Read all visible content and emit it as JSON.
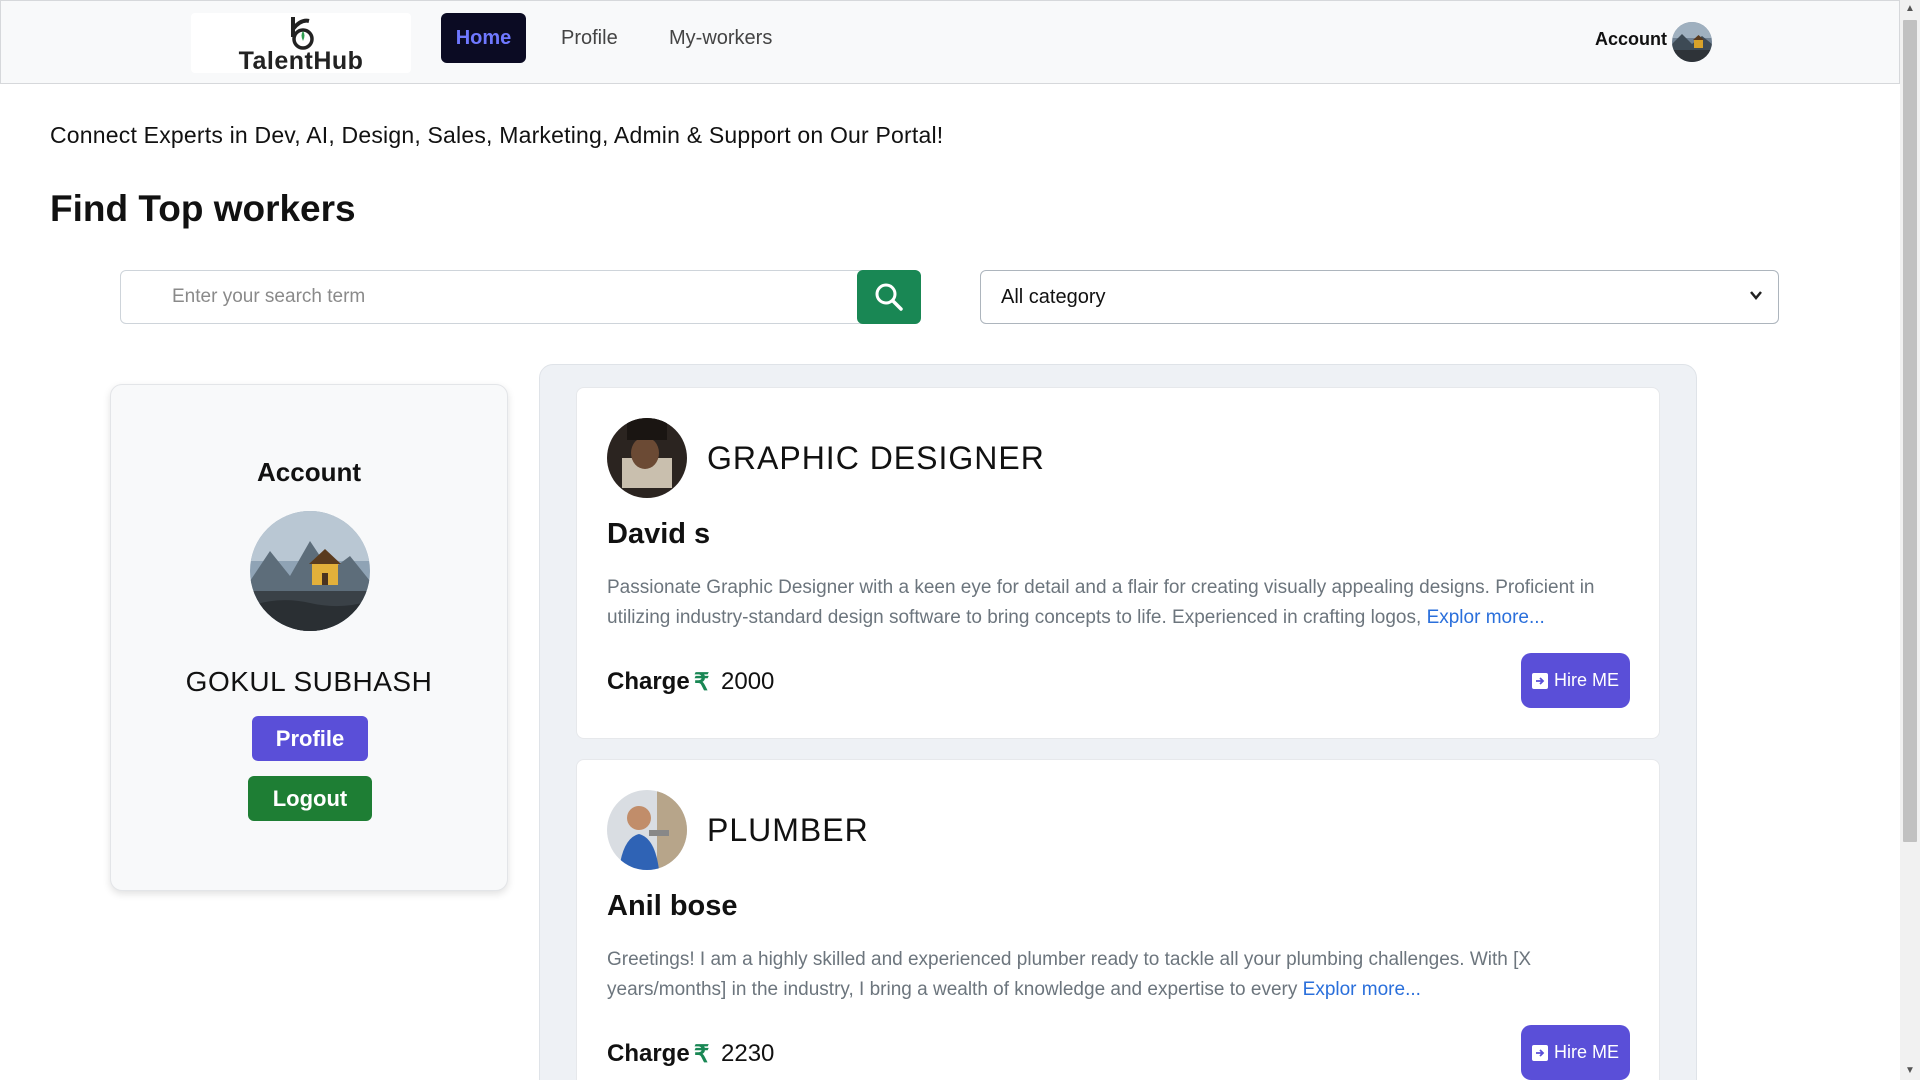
{
  "navbar": {
    "logo_text": "TalentHub",
    "links": [
      {
        "label": "Home",
        "active": true
      },
      {
        "label": "Profile"
      },
      {
        "label": "My-workers"
      }
    ],
    "account_label": "Account"
  },
  "hero": {
    "tagline": "Connect Experts in Dev, AI, Design, Sales, Marketing, Admin & Support on Our Portal!",
    "title": "Find Top workers"
  },
  "search": {
    "placeholder": "Enter your search term",
    "value": "",
    "icon": "search-icon"
  },
  "category": {
    "selected": "All category"
  },
  "account_card": {
    "title": "Account",
    "name": "GOKUL SUBHASH",
    "profile_button": "Profile",
    "logout_button": "Logout"
  },
  "workers": [
    {
      "category": "GRAPHIC DESIGNER",
      "name": "David s",
      "description": "Passionate Graphic Designer with a keen eye for detail and a flair for creating visually appealing designs. Proficient in utilizing industry-standard design software to bring concepts to life. Experienced in crafting logos, ",
      "more_link": "Explor more...",
      "charge_label": "Charge",
      "currency": "₹",
      "charge": "2000",
      "hire_label": "Hire ME"
    },
    {
      "category": "PLUMBER",
      "name": "Anil bose",
      "description": "Greetings! I am a highly skilled and experienced plumber ready to tackle all your plumbing challenges. With [X years/months] in the industry, I bring a wealth of knowledge and expertise to every ",
      "more_link": "Explor more...",
      "charge_label": "Charge",
      "currency": "₹",
      "charge": "2230",
      "hire_label": "Hire ME"
    }
  ],
  "colors": {
    "brand": "#5a4fd8",
    "success": "#198754",
    "nav_active_bg": "#0b0b23",
    "link": "#2a6fdb"
  }
}
